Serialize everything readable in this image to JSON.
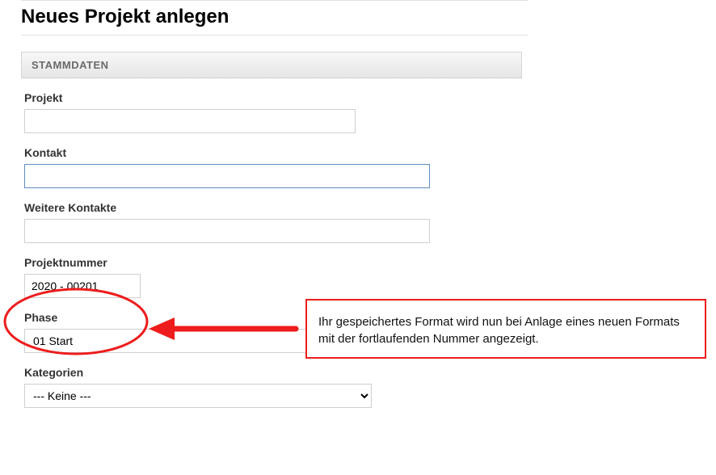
{
  "pageTitle": "Neues Projekt anlegen",
  "panelHeader": "STAMMDATEN",
  "labels": {
    "projekt": "Projekt",
    "kontakt": "Kontakt",
    "weitereKontakte": "Weitere Kontakte",
    "projektnummer": "Projektnummer",
    "phase": "Phase",
    "kategorien": "Kategorien"
  },
  "values": {
    "projekt": "",
    "kontakt": "",
    "weitereKontakte": "",
    "projektnummer": "2020 - 00201",
    "phaseSelected": "01 Start",
    "kategorienSelected": "--- Keine ---"
  },
  "annotation": {
    "text": "Ihr gespeichertes Format wird nun bei Anlage eines neuen Formats mit der fortlaufenden Nummer angezeigt."
  }
}
